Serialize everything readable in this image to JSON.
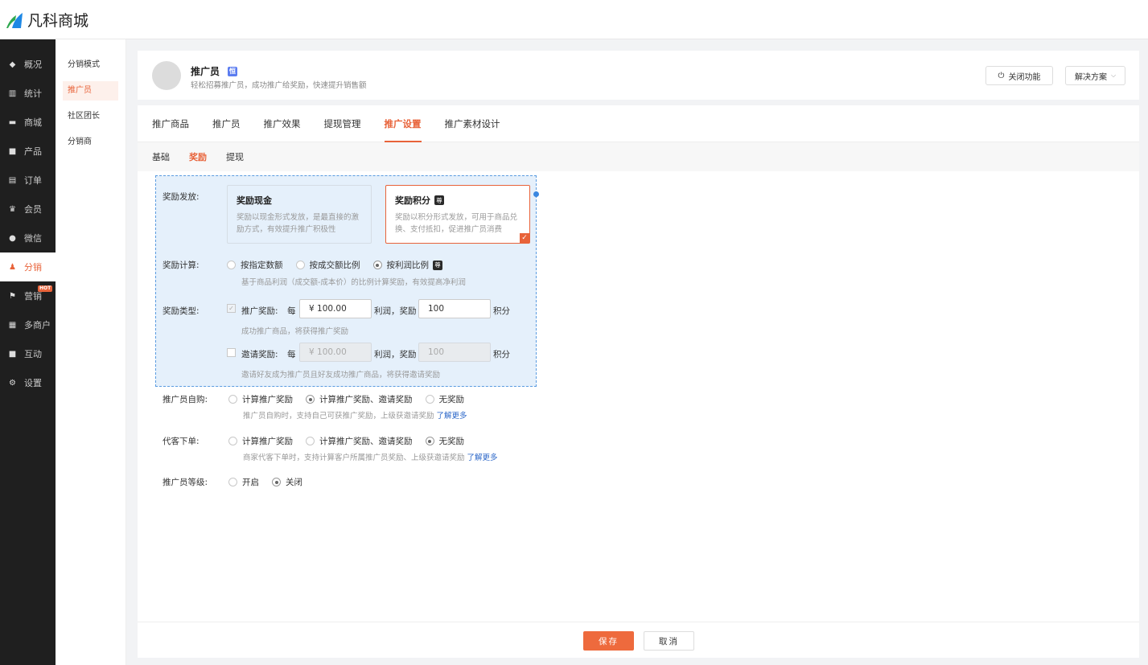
{
  "app": {
    "logo_text": "凡科商城"
  },
  "sidebar": {
    "items": [
      {
        "label": "概况",
        "icon": "graduation-cap-icon",
        "glyph": "◆"
      },
      {
        "label": "统计",
        "icon": "chart-icon",
        "glyph": "▥"
      },
      {
        "label": "商城",
        "icon": "store-icon",
        "glyph": "▬"
      },
      {
        "label": "产品",
        "icon": "grid-icon",
        "glyph": "■"
      },
      {
        "label": "订单",
        "icon": "order-icon",
        "glyph": "▤"
      },
      {
        "label": "会员",
        "icon": "crown-icon",
        "glyph": "♛"
      },
      {
        "label": "微信",
        "icon": "wechat-icon",
        "glyph": "●"
      },
      {
        "label": "分销",
        "icon": "distribution-icon",
        "glyph": "♟"
      },
      {
        "label": "营销",
        "icon": "flag-icon",
        "glyph": "⚑",
        "badge": "HOT"
      },
      {
        "label": "多商户",
        "icon": "merchant-icon",
        "glyph": "▦"
      },
      {
        "label": "互动",
        "icon": "interact-icon",
        "glyph": "■"
      },
      {
        "label": "设置",
        "icon": "gear-icon",
        "glyph": "⚙"
      }
    ]
  },
  "subnav": {
    "items": [
      "分销模式",
      "推广员",
      "社区团长",
      "分销商"
    ]
  },
  "header": {
    "title": "推广员",
    "badge": "恒",
    "desc": "轻松招募推广员，成功推广给奖励，快速提升销售额",
    "close_btn": "关闭功能",
    "solution_btn": "解决方案"
  },
  "tabs": [
    "推广商品",
    "推广员",
    "推广效果",
    "提现管理",
    "推广设置",
    "推广素材设计"
  ],
  "subtabs": [
    "基础",
    "奖励",
    "提现"
  ],
  "form": {
    "reward_issue": {
      "label": "奖励发放:",
      "cash": {
        "title": "奖励现金",
        "desc": "奖励以现金形式发放，是最直接的激励方式，有效提升推广积极性"
      },
      "points": {
        "title": "奖励积分",
        "badge": "尊",
        "desc": "奖励以积分形式发放，可用于商品兑换、支付抵扣，促进推广员消费"
      }
    },
    "reward_calc": {
      "label": "奖励计算:",
      "options": [
        "按指定数额",
        "按成交额比例",
        "按利润比例"
      ],
      "badge": "尊",
      "hint": "基于商品利润（成交额-成本价）的比例计算奖励，有效提高净利润"
    },
    "reward_type": {
      "label": "奖励类型:",
      "promo": {
        "label": "推广奖励:",
        "each": "每",
        "amount": "¥ 100.00",
        "mid": "利润，奖励",
        "points": "100",
        "unit": "积分",
        "hint": "成功推广商品，将获得推广奖励"
      },
      "invite": {
        "label": "邀请奖励:",
        "each": "每",
        "amount": "¥ 100.00",
        "mid": "利润，奖励",
        "points": "100",
        "unit": "积分",
        "hint": "邀请好友成为推广员且好友成功推广商品，将获得邀请奖励"
      }
    },
    "self_buy": {
      "label": "推广员自购:",
      "options": [
        "计算推广奖励",
        "计算推广奖励、邀请奖励",
        "无奖励"
      ],
      "hint": "推广员自购时，支持自己可获推广奖励，上级获邀请奖励",
      "link": "了解更多"
    },
    "proxy_order": {
      "label": "代客下单:",
      "options": [
        "计算推广奖励",
        "计算推广奖励、邀请奖励",
        "无奖励"
      ],
      "hint": "商家代客下单时，支持计算客户所属推广员奖励、上级获邀请奖励",
      "link": "了解更多"
    },
    "level": {
      "label": "推广员等级:",
      "options": [
        "开启",
        "关闭"
      ]
    }
  },
  "footer": {
    "save": "保存",
    "cancel": "取消"
  },
  "colors": {
    "accent": "#e8633a",
    "sidebar_bg": "#1f1f1f",
    "selection": "#e5f0fb",
    "link": "#2a66c8"
  }
}
